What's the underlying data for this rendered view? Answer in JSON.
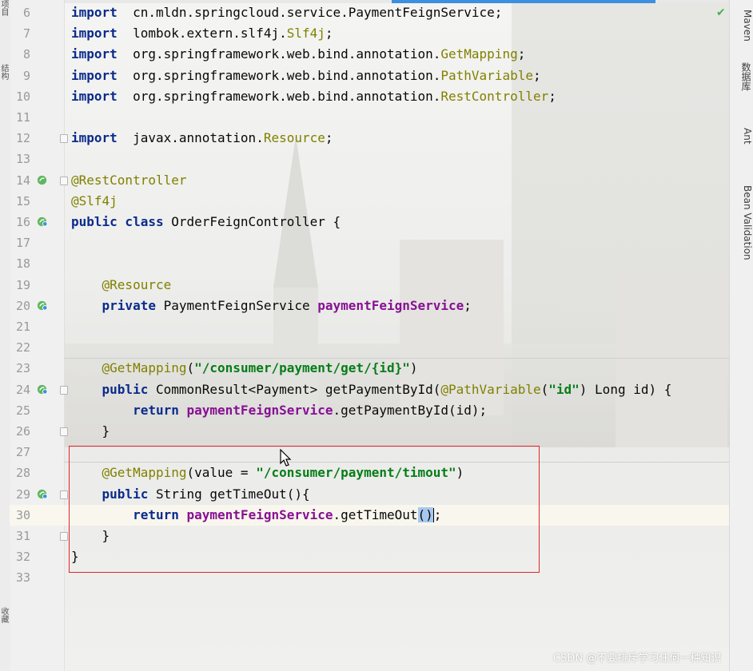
{
  "editor": {
    "lines": [
      {
        "num": "6",
        "code": [
          [
            "kw",
            "import"
          ],
          [
            "",
            "  cn.mldn.springcloud.service.PaymentFeignService;"
          ]
        ]
      },
      {
        "num": "7",
        "code": [
          [
            "kw",
            "import"
          ],
          [
            "",
            "  lombok.extern.slf4j."
          ],
          [
            "cls",
            "Slf4j"
          ],
          [
            "",
            ";"
          ]
        ]
      },
      {
        "num": "8",
        "code": [
          [
            "kw",
            "import"
          ],
          [
            "",
            "  org.springframework.web.bind.annotation."
          ],
          [
            "cls",
            "GetMapping"
          ],
          [
            "",
            ";"
          ]
        ]
      },
      {
        "num": "9",
        "code": [
          [
            "kw",
            "import"
          ],
          [
            "",
            "  org.springframework.web.bind.annotation."
          ],
          [
            "cls",
            "PathVariable"
          ],
          [
            "",
            ";"
          ]
        ]
      },
      {
        "num": "10",
        "code": [
          [
            "kw",
            "import"
          ],
          [
            "",
            "  org.springframework.web.bind.annotation."
          ],
          [
            "cls",
            "RestController"
          ],
          [
            "",
            ";"
          ]
        ]
      },
      {
        "num": "11",
        "code": []
      },
      {
        "num": "12",
        "code": [
          [
            "kw",
            "import"
          ],
          [
            "",
            "  javax.annotation."
          ],
          [
            "cls",
            "Resource"
          ],
          [
            "",
            ";"
          ]
        ]
      },
      {
        "num": "13",
        "code": []
      },
      {
        "num": "14",
        "code": [
          [
            "ann",
            "@RestController"
          ]
        ]
      },
      {
        "num": "15",
        "code": [
          [
            "ann",
            "@Slf4j"
          ]
        ]
      },
      {
        "num": "16",
        "code": [
          [
            "kw",
            "public class"
          ],
          [
            "",
            " OrderFeignController {"
          ]
        ]
      },
      {
        "num": "17",
        "code": []
      },
      {
        "num": "18",
        "code": []
      },
      {
        "num": "19",
        "code": [
          [
            "",
            "    "
          ],
          [
            "ann",
            "@Resource"
          ]
        ]
      },
      {
        "num": "20",
        "code": [
          [
            "",
            "    "
          ],
          [
            "kw",
            "private"
          ],
          [
            "",
            " PaymentFeignService "
          ],
          [
            "field",
            "paymentFeignService"
          ],
          [
            "",
            ";"
          ]
        ]
      },
      {
        "num": "21",
        "code": []
      },
      {
        "num": "22",
        "code": []
      },
      {
        "num": "23",
        "code": [
          [
            "",
            "    "
          ],
          [
            "ann",
            "@GetMapping"
          ],
          [
            "",
            "("
          ],
          [
            "str",
            "\"/consumer/payment/get/{id}\""
          ],
          [
            "",
            ")"
          ]
        ]
      },
      {
        "num": "24",
        "code": [
          [
            "",
            "    "
          ],
          [
            "kw",
            "public"
          ],
          [
            "",
            " CommonResult<Payment> getPaymentById("
          ],
          [
            "ann",
            "@PathVariable"
          ],
          [
            "",
            "("
          ],
          [
            "str",
            "\"id\""
          ],
          [
            "",
            ") Long id) {"
          ]
        ]
      },
      {
        "num": "25",
        "code": [
          [
            "",
            "        "
          ],
          [
            "kw",
            "return"
          ],
          [
            "",
            " "
          ],
          [
            "field",
            "paymentFeignService"
          ],
          [
            "",
            ".getPaymentById(id);"
          ]
        ]
      },
      {
        "num": "26",
        "code": [
          [
            "",
            "    }"
          ]
        ]
      },
      {
        "num": "27",
        "code": []
      },
      {
        "num": "28",
        "code": [
          [
            "",
            "    "
          ],
          [
            "ann",
            "@GetMapping"
          ],
          [
            "",
            "(value = "
          ],
          [
            "str",
            "\"/consumer/payment/timout\""
          ],
          [
            "",
            ")"
          ]
        ]
      },
      {
        "num": "29",
        "code": [
          [
            "",
            "    "
          ],
          [
            "kw",
            "public"
          ],
          [
            "",
            " String getTimeOut(){"
          ]
        ]
      },
      {
        "num": "30",
        "code": [
          [
            "",
            "        "
          ],
          [
            "kw",
            "return"
          ],
          [
            "",
            " "
          ],
          [
            "field",
            "paymentFeignService"
          ],
          [
            "",
            ".getTimeOut"
          ],
          [
            "caret",
            "()"
          ],
          [
            "caretbar",
            ""
          ],
          [
            "",
            ";"
          ]
        ]
      },
      {
        "num": "31",
        "code": [
          [
            "",
            "    }"
          ]
        ]
      },
      {
        "num": "32",
        "code": [
          [
            "",
            "}"
          ]
        ]
      },
      {
        "num": "33",
        "code": []
      }
    ]
  },
  "right_tools": [
    "Maven",
    "数据库",
    "Ant",
    "Bean Validation"
  ],
  "left_tools": [
    "项目",
    "结构",
    "收藏"
  ],
  "watermark": "CSDN @不要排斥学习任何一种知识",
  "colors": {
    "keyword": "#0b2b8c",
    "annotation": "#808000",
    "string": "#067d17",
    "field": "#871094",
    "highlight_box": "#e0262b",
    "line_numbers": "#9a9a9a"
  }
}
